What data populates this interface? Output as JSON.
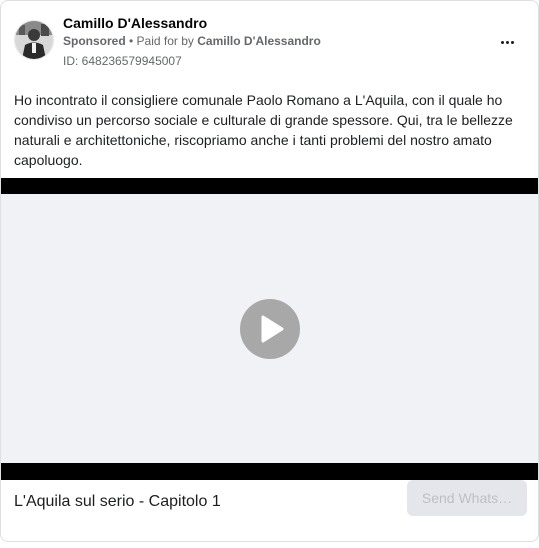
{
  "post": {
    "author_name": "Camillo D'Alessandro",
    "sponsored_label": "Sponsored",
    "separator": " • ",
    "paid_for_prefix": "Paid for by ",
    "paid_for_name": "Camillo D'Alessandro",
    "ad_id": "ID: 648236579945007",
    "more_icon": "more-options-icon",
    "body_text": "Ho incontrato il consigliere comunale Paolo Romano a L'Aquila, con il quale ho condiviso un percorso sociale e culturale di grande spessore. Qui, tra le bellezze naturali e architettoniche, riscopriamo anche i tanti problemi del nostro amato capoluogo."
  },
  "media": {
    "type": "video",
    "play_icon": "play-icon"
  },
  "footer": {
    "link_title": "L'Aquila sul serio - Capitolo 1",
    "cta_label": "Send Whats…"
  },
  "colors": {
    "muted_text": "#65676b",
    "button_bg": "#e4e6eb",
    "button_text_disabled": "#bcc0c4",
    "play_button": "#a8a8a8",
    "letterbox": "#000000"
  }
}
